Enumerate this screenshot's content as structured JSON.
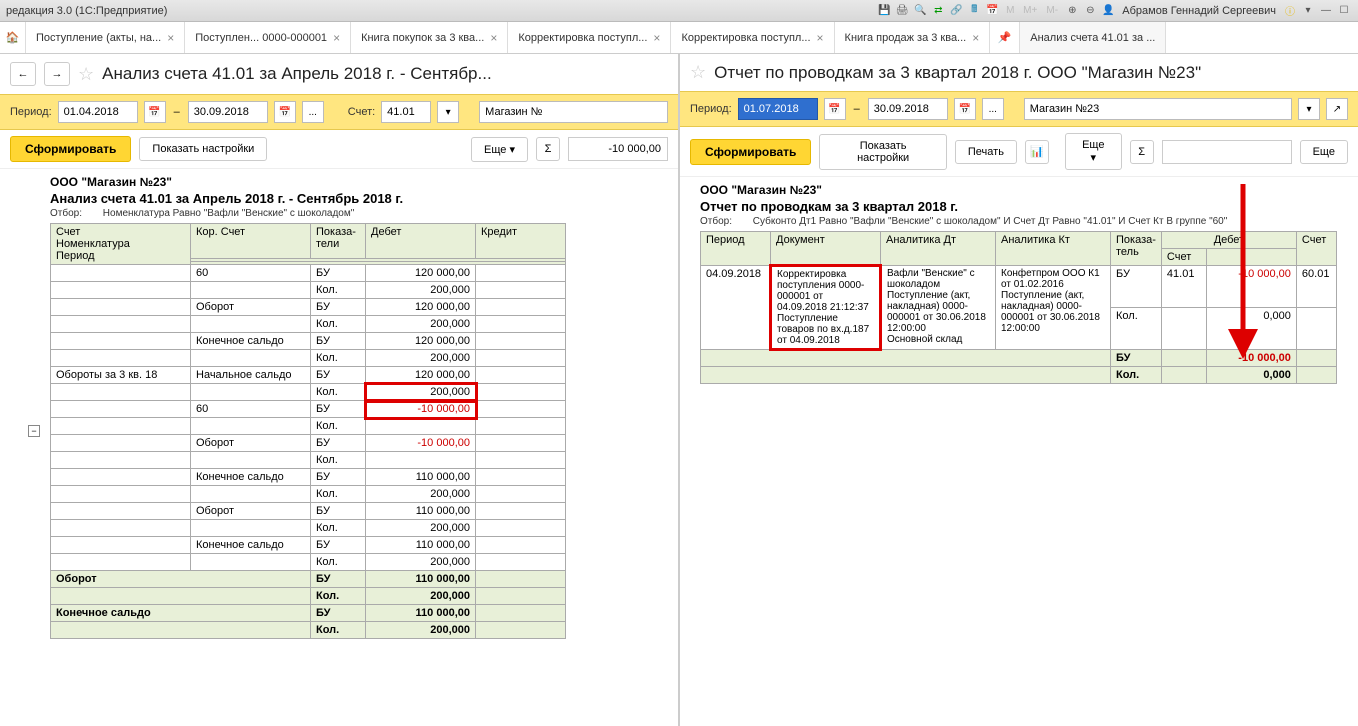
{
  "titlebar": {
    "app_title": "редакция 3.0 (1С:Предприятие)",
    "user_name": "Абрамов Геннадий Сергеевич",
    "labels": {
      "m": "М",
      "m_plus": "М+",
      "m_minus": "М-"
    }
  },
  "tabs": [
    {
      "label": "Поступление (акты, на..."
    },
    {
      "label": "Поступлен... 0000-000001"
    },
    {
      "label": "Книга покупок за 3 ква..."
    },
    {
      "label": "Корректировка поступл..."
    },
    {
      "label": "Корректировка поступл..."
    },
    {
      "label": "Книга продаж за 3 ква..."
    },
    {
      "label": "Анализ счета 41.01 за ..."
    }
  ],
  "left": {
    "title": "Анализ счета 41.01 за Апрель 2018 г. - Сентябр...",
    "filter": {
      "period_label": "Период:",
      "from": "01.04.2018",
      "to": "30.09.2018",
      "account_label": "Счет:",
      "account": "41.01",
      "org": "Магазин №"
    },
    "actions": {
      "form": "Сформировать",
      "settings": "Показать настройки",
      "more": "Еще",
      "amount": "-10 000,00"
    },
    "report": {
      "org": "ООО \"Магазин №23\"",
      "title": "Анализ счета 41.01 за Апрель 2018 г. - Сентябрь 2018 г.",
      "filter_label": "Отбор:",
      "filter_text": "Номенклатура Равно \"Вафли \"Венские\" с шоколадом\"",
      "headers": {
        "account": "Счет",
        "nomenclature": "Номенклатура",
        "period": "Период",
        "cor_account": "Кор. Счет",
        "indicator": "Показа-\nтели",
        "debit": "Дебет",
        "credit": "Кредит"
      },
      "rows": [
        {
          "c1": "",
          "c2": "60",
          "c3": "БУ",
          "d": "120 000,00",
          "k": ""
        },
        {
          "c1": "",
          "c2": "",
          "c3": "Кол.",
          "d": "200,000",
          "k": ""
        },
        {
          "c1": "",
          "c2": "Оборот",
          "c3": "БУ",
          "d": "120 000,00",
          "k": ""
        },
        {
          "c1": "",
          "c2": "",
          "c3": "Кол.",
          "d": "200,000",
          "k": ""
        },
        {
          "c1": "",
          "c2": "Конечное сальдо",
          "c3": "БУ",
          "d": "120 000,00",
          "k": ""
        },
        {
          "c1": "",
          "c2": "",
          "c3": "Кол.",
          "d": "200,000",
          "k": ""
        },
        {
          "c1": "Обороты за 3 кв. 18",
          "c2": "Начальное сальдо",
          "c3": "БУ",
          "d": "120 000,00",
          "k": ""
        },
        {
          "c1": "",
          "c2": "",
          "c3": "Кол.",
          "d": "200,000",
          "k": "",
          "hl": true
        },
        {
          "c1": "",
          "c2": "60",
          "c3": "БУ",
          "d": "-10 000,00",
          "k": "",
          "neg": true,
          "hl": true
        },
        {
          "c1": "",
          "c2": "",
          "c3": "Кол.",
          "d": "",
          "k": ""
        },
        {
          "c1": "",
          "c2": "Оборот",
          "c3": "БУ",
          "d": "-10 000,00",
          "k": "",
          "neg": true
        },
        {
          "c1": "",
          "c2": "",
          "c3": "Кол.",
          "d": "",
          "k": ""
        },
        {
          "c1": "",
          "c2": "Конечное сальдо",
          "c3": "БУ",
          "d": "110 000,00",
          "k": ""
        },
        {
          "c1": "",
          "c2": "",
          "c3": "Кол.",
          "d": "200,000",
          "k": ""
        },
        {
          "c1": "",
          "c2": "Оборот",
          "c3": "БУ",
          "d": "110 000,00",
          "k": ""
        },
        {
          "c1": "",
          "c2": "",
          "c3": "Кол.",
          "d": "200,000",
          "k": ""
        },
        {
          "c1": "",
          "c2": "Конечное сальдо",
          "c3": "БУ",
          "d": "110 000,00",
          "k": ""
        },
        {
          "c1": "",
          "c2": "",
          "c3": "Кол.",
          "d": "200,000",
          "k": ""
        }
      ],
      "totals": [
        {
          "label": "Оборот",
          "c3": "БУ",
          "d": "110 000,00"
        },
        {
          "label": "",
          "c3": "Кол.",
          "d": "200,000"
        },
        {
          "label": "Конечное сальдо",
          "c3": "БУ",
          "d": "110 000,00"
        },
        {
          "label": "",
          "c3": "Кол.",
          "d": "200,000"
        }
      ]
    }
  },
  "right": {
    "title": "Отчет по проводкам за 3 квартал 2018 г. ООО \"Магазин №23\"",
    "filter": {
      "period_label": "Период:",
      "from": "01.07.2018",
      "to": "30.09.2018",
      "org": "Магазин №23"
    },
    "actions": {
      "form": "Сформировать",
      "settings": "Показать настройки",
      "print": "Печать",
      "more": "Еще"
    },
    "report": {
      "org": "ООО \"Магазин №23\"",
      "title": "Отчет по проводкам за 3 квартал 2018 г.",
      "filter_label": "Отбор:",
      "filter_text": "Субконто Дт1 Равно \"Вафли \"Венские\" с шоколадом\" И Счет Дт Равно \"41.01\" И Счет Кт В группе \"60\"",
      "headers": {
        "period": "Период",
        "document": "Документ",
        "analytics_dt": "Аналитика Дт",
        "analytics_kt": "Аналитика Кт",
        "indicator": "Показа-\nтель",
        "debit": "Дебет",
        "account": "Счет",
        "account2": "Счет"
      },
      "row": {
        "period": "04.09.2018",
        "document": "Корректировка поступления 0000-000001 от 04.09.2018 21:12:37 Поступление товаров по вх.д.187 от 04.09.2018",
        "an_dt": "Вафли \"Венские\" с шоколадом\nПоступление (акт, накладная) 0000-000001 от 30.06.2018 12:00:00\nОсновной склад",
        "an_kt": "Конфетпром ООО К1 от 01.02.2016\nПоступление (акт, накладная) 0000-000001 от 30.06.2018 12:00:00",
        "ind1": "БУ",
        "acc1": "41.01",
        "val1": "-10 000,00",
        "acc2": "60.01",
        "ind2": "Кол.",
        "val2": "0,000"
      },
      "totals": {
        "ind1": "БУ",
        "val1": "-10 000,00",
        "ind2": "Кол.",
        "val2": "0,000"
      }
    }
  }
}
